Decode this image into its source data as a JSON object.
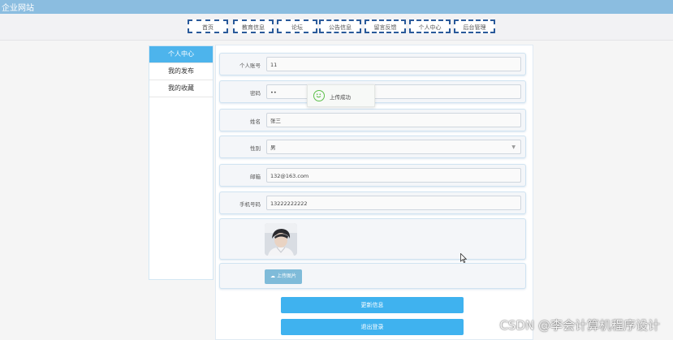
{
  "app": {
    "title": "企业网站"
  },
  "nav": {
    "items": [
      {
        "label": "首页"
      },
      {
        "label": "教育信息"
      },
      {
        "label": "论坛"
      },
      {
        "label": "公告信息"
      },
      {
        "label": "留言反馈"
      },
      {
        "label": "个人中心"
      },
      {
        "label": "后台管理"
      }
    ]
  },
  "sidebar": {
    "items": [
      {
        "label": "个人中心",
        "active": true
      },
      {
        "label": "我的发布",
        "active": false
      },
      {
        "label": "我的收藏",
        "active": false
      }
    ]
  },
  "form": {
    "account": {
      "label": "个人账号",
      "value": "11"
    },
    "password": {
      "label": "密码",
      "value": "••"
    },
    "name": {
      "label": "姓名",
      "value": "张三"
    },
    "gender": {
      "label": "性别",
      "value": "男"
    },
    "email": {
      "label": "邮箱",
      "value": "132@163.com"
    },
    "phone": {
      "label": "手机号码",
      "value": "13222222222"
    },
    "upload_label": "上传图片"
  },
  "actions": {
    "update_label": "更新信息",
    "logout_label": "退出登录"
  },
  "toast": {
    "message": "上传成功"
  },
  "watermark": "CSDN @李会计算机程序设计",
  "colors": {
    "accent": "#3fb2ef",
    "titlebar": "#8bbde0",
    "nav_border": "#2a5a9a",
    "success": "#5cbf4a"
  },
  "icons": {
    "toast": "smile-icon",
    "upload": "cloud-upload-icon",
    "select": "chevron-down-icon"
  }
}
